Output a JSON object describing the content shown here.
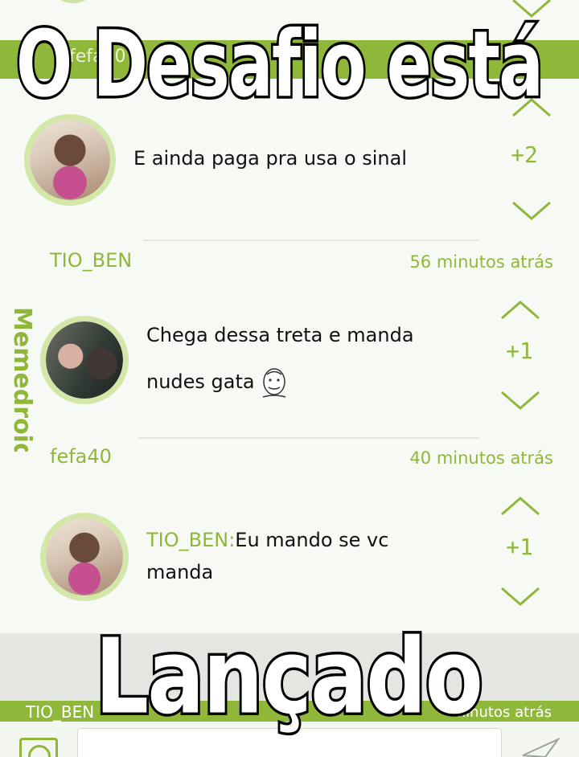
{
  "captions": {
    "top": "O Desafio está",
    "bottom": "Lançado"
  },
  "top_bar": {
    "username_partial": "fefa40"
  },
  "comments": [
    {
      "text": "E ainda paga pra usa o sinal",
      "score": "+2"
    },
    {
      "username": "TIO_BEN",
      "time": "56 minutos atrás",
      "text_line1": "Chega dessa treta e manda",
      "text_line2": "nudes gata",
      "score": "+1"
    },
    {
      "username": "fefa40",
      "time": "40 minutos atrás",
      "reply_to": "TIO_BEN:",
      "text_line1": "Eu mando se vc",
      "text_line2": "manda",
      "score": "+1"
    }
  ],
  "bottom_bar": {
    "username_partial": "TIO_BEN",
    "time_partial": "minutos atrás"
  },
  "watermark": "Memedroid",
  "colors": {
    "accent": "#8fb73a",
    "background": "#f7faf4",
    "avatar_ring": "#d3e7a9"
  },
  "icons": {
    "upvote": "chevron-up-icon",
    "downvote": "chevron-down-icon",
    "emoji": "emoji-icon",
    "send": "send-icon"
  }
}
